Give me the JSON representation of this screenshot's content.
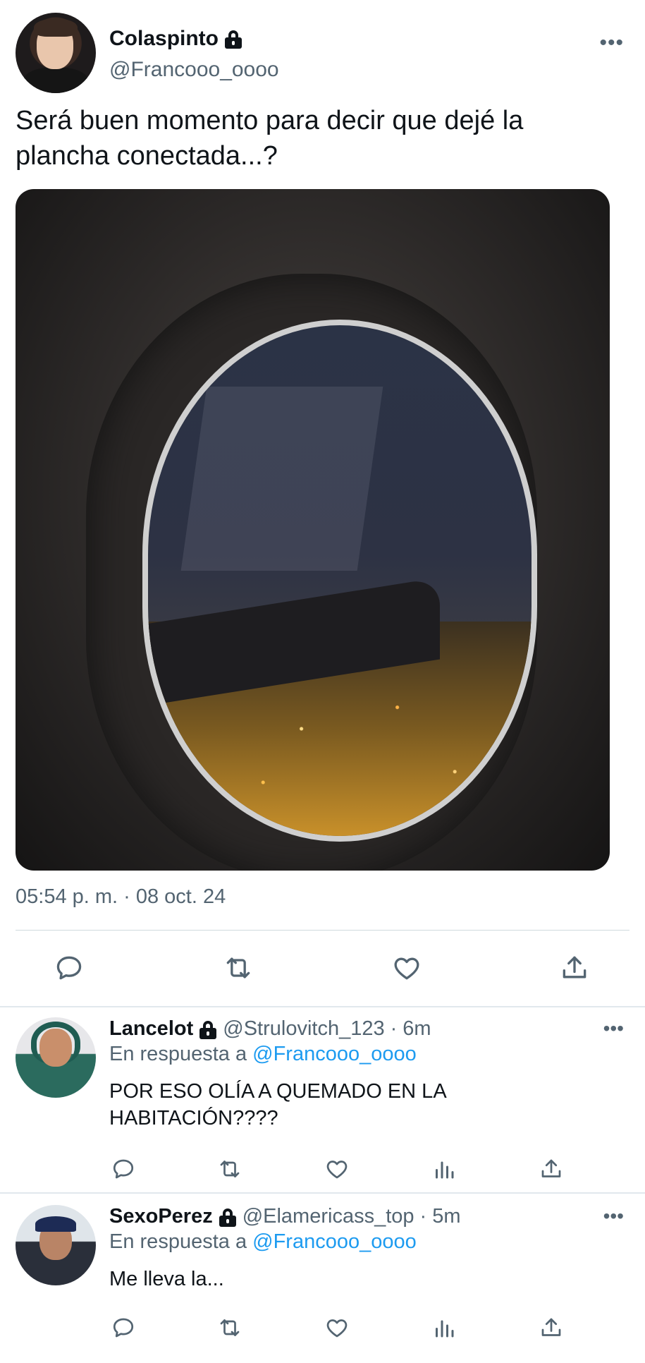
{
  "main_tweet": {
    "display_name": "Colaspinto",
    "handle": "@Francooo_oooo",
    "more_label": "•••",
    "text": "Será buen momento para decir que dejé la plancha conectada...?",
    "timestamp": "05:54 p. m. · 08 oct. 24",
    "actions": [
      "reply-icon",
      "retweet-icon",
      "like-icon",
      "share-icon"
    ]
  },
  "replies": [
    {
      "display_name": "Lancelot",
      "handle": "@Strulovitch_123",
      "time": "· 6m",
      "reply_prefix": "En respuesta a",
      "reply_to": "@Francooo_oooo",
      "text": "POR ESO OLÍA A QUEMADO EN LA HABITACIÓN????",
      "more_label": "•••"
    },
    {
      "display_name": "SexoPerez",
      "handle": "@Elamericass_top",
      "time": "· 5m",
      "reply_prefix": "En respuesta a",
      "reply_to": "@Francooo_oooo",
      "text": "Me lleva la...",
      "more_label": "•••"
    }
  ],
  "colors": {
    "text": "#0f1419",
    "secondary": "#536471",
    "link": "#1d9bf0",
    "divider": "#cfd9de"
  }
}
